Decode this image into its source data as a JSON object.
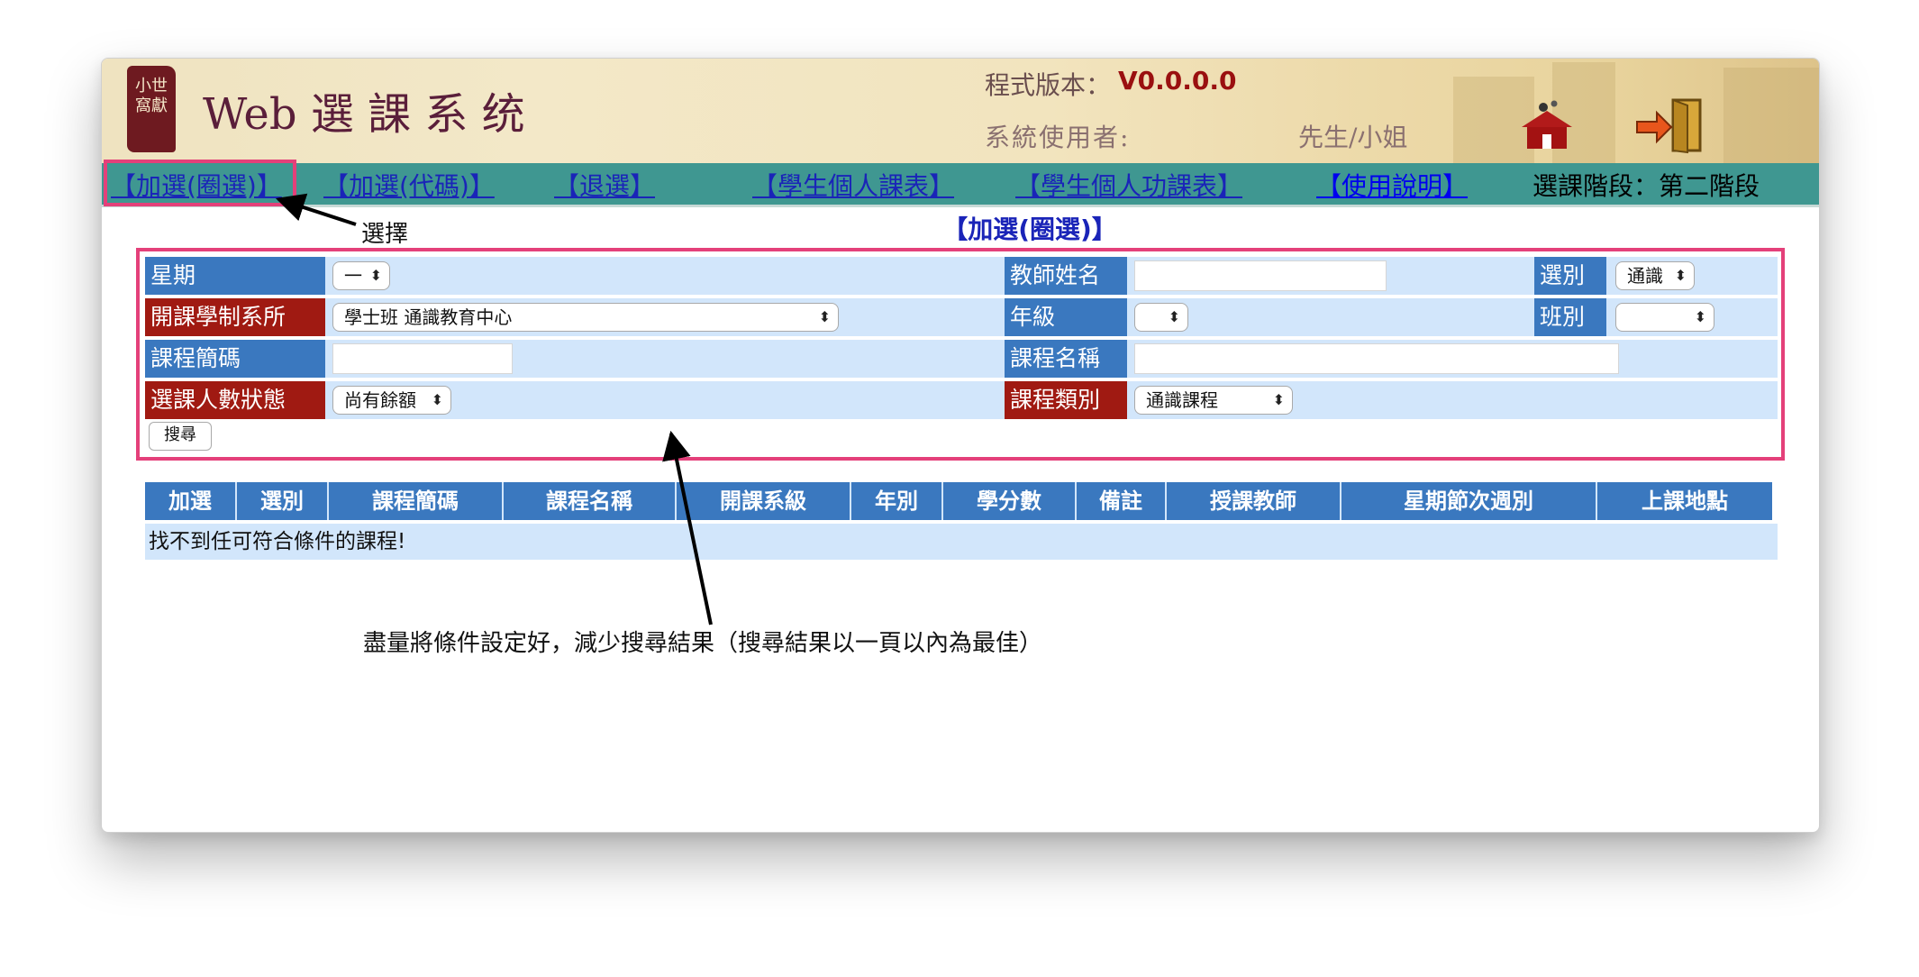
{
  "header": {
    "logo_text": "小世\n窩獻",
    "app_title": "Web 選 課 系 统",
    "version_label": "程式版本：",
    "version_value": "V0.0.0.0",
    "user_label": "系統使用者:",
    "user_title": "先生/小姐"
  },
  "menu": {
    "items": [
      {
        "label": "【加選(圈選)】"
      },
      {
        "label": "【加選(代碼)】"
      },
      {
        "label": "【退選】"
      },
      {
        "label": "【學生個人課表】"
      },
      {
        "label": "【學生個人功課表】"
      },
      {
        "label": "【使用說明】"
      }
    ],
    "stage": "選課階段：第二階段"
  },
  "annotations": {
    "select_note": "選擇",
    "tip": "盡量將條件設定好，減少搜尋結果（搜尋結果以一頁以內為最佳）"
  },
  "page": {
    "heading": "【加選(圈選)】"
  },
  "form": {
    "weekday_label": "星期",
    "weekday_value": "一",
    "teacher_label": "教師姓名",
    "teacher_value": "",
    "category_label": "選別",
    "category_value": "通識",
    "dept_label": "開課學制系所",
    "dept_value": "學士班 通識教育中心",
    "grade_label": "年級",
    "grade_value": "",
    "class_label": "班別",
    "class_value": "",
    "course_code_label": "課程簡碼",
    "course_code_value": "",
    "course_name_label": "課程名稱",
    "course_name_value": "",
    "enroll_status_label": "選課人數狀態",
    "enroll_status_value": "尚有餘額",
    "course_type_label": "課程類別",
    "course_type_value": "通識課程",
    "search_button": "搜尋"
  },
  "table": {
    "headers": [
      "加選",
      "選別",
      "課程簡碼",
      "課程名稱",
      "開課系級",
      "年別",
      "學分數",
      "備註",
      "授課教師",
      "星期節次週別",
      "上課地點"
    ],
    "empty_message": "找不到任可符合條件的課程!"
  },
  "colors": {
    "menu_bg": "#3f9791",
    "label_blue": "#3a78bf",
    "label_red": "#a01a12",
    "row_bg": "#d2e6fb",
    "highlight_frame": "#e4407a",
    "link": "#1a24b8"
  }
}
